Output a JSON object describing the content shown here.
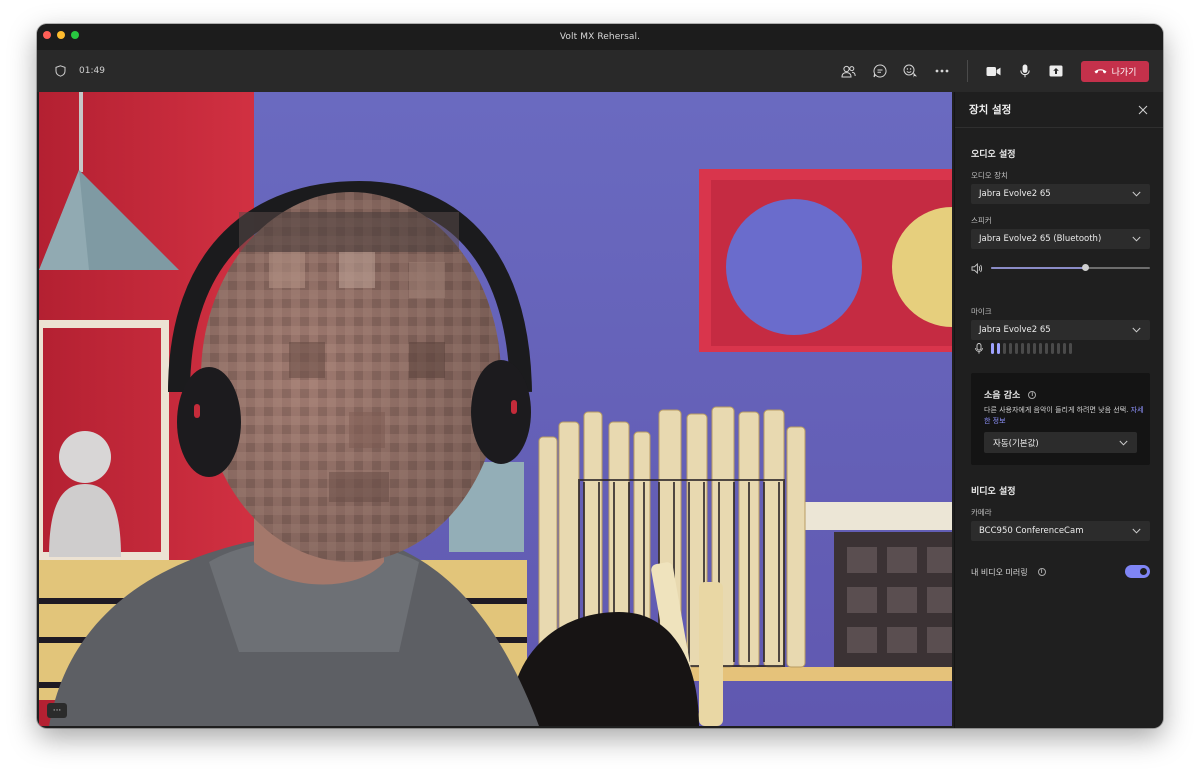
{
  "window": {
    "title": "Volt MX Rehersal."
  },
  "toolbar": {
    "timer": "01:49",
    "icons": [
      "shield-icon",
      "people-icon",
      "chat-icon",
      "reactions-icon",
      "more-icon",
      "camera-icon",
      "mic-icon",
      "share-icon"
    ],
    "leave_label": "나가기",
    "leave_color": "#c4314b"
  },
  "video": {
    "more_label": "···"
  },
  "panel": {
    "title": "장치 설정",
    "audio": {
      "section_title": "오디오 설정",
      "device_label": "오디오 장치",
      "device_value": "Jabra Evolve2 65",
      "speaker_label": "스피커",
      "speaker_value": "Jabra Evolve2 65 (Bluetooth)",
      "speaker_volume_fraction": 0.6,
      "mic_label": "마이크",
      "mic_value": "Jabra Evolve2 65",
      "mic_level_active_bars": 2,
      "mic_level_total_bars": 14
    },
    "noise": {
      "title": "소음 감소",
      "description": "다른 사용자에게 음악이 들리게 하려면 낮음 선택.",
      "link": "자세한 정보",
      "value": "자동(기본값)"
    },
    "video": {
      "section_title": "비디오 설정",
      "camera_label": "카메라",
      "camera_value": "BCC950 ConferenceCam",
      "mirror_label": "내 비디오 미러링",
      "mirror_on": true
    },
    "accent_color": "#7f85f5"
  }
}
